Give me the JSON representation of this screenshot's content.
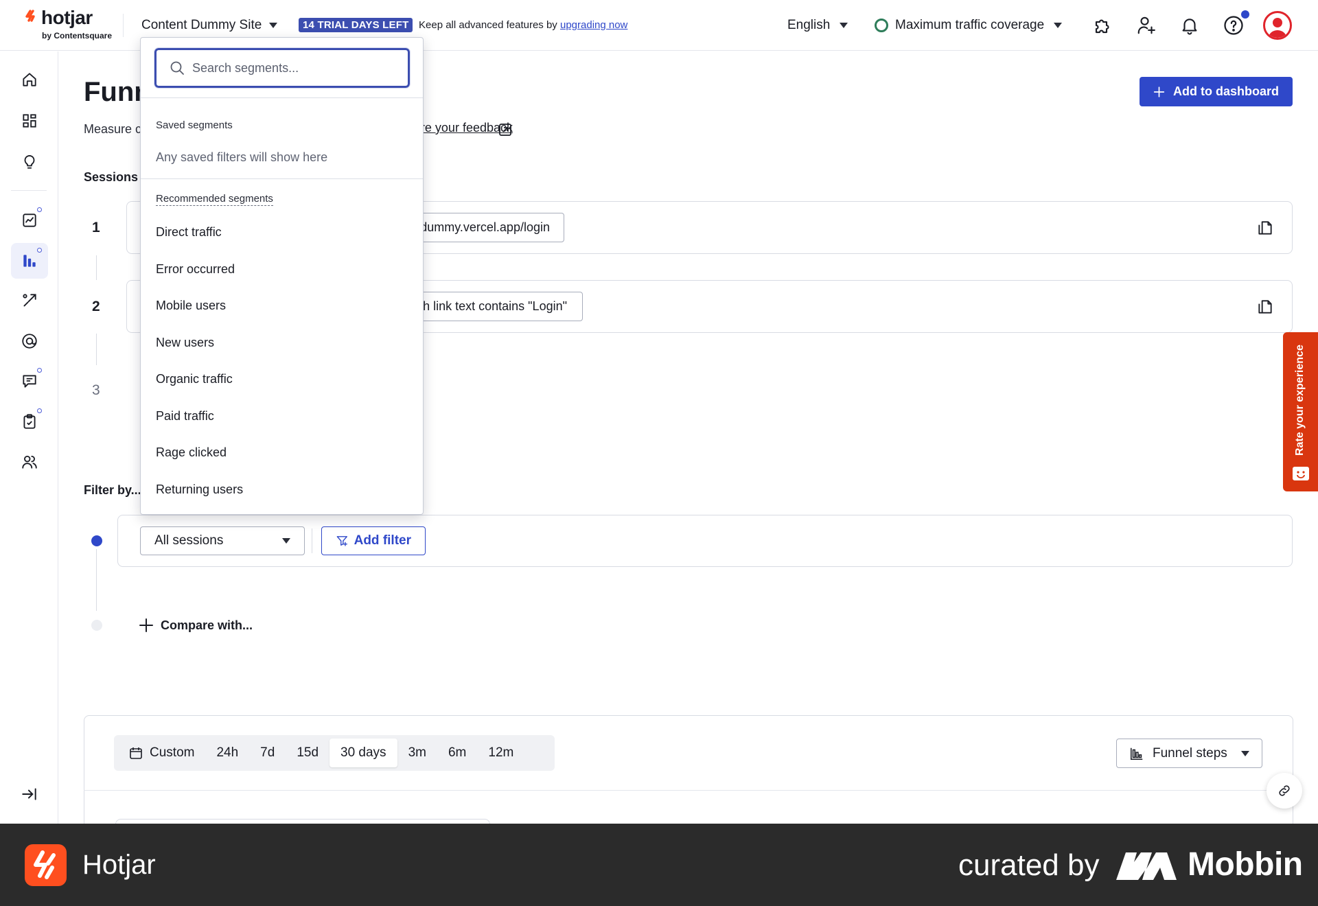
{
  "topbar": {
    "logo_text": "hotjar",
    "logo_sub": "by Contentsquare",
    "site_name": "Content Dummy Site",
    "trial_badge": "14 TRIAL DAYS LEFT",
    "trial_msg": "Keep all advanced features by",
    "upgrade_link": "upgrading now",
    "language": "English",
    "coverage": "Maximum traffic coverage"
  },
  "page": {
    "title": "Funnels",
    "subtitle": "Measure conversion and drop-off through your key flows.",
    "feedback_link": "Share your feedback",
    "add_dashboard": "Add to dashboard",
    "sessions_label": "Sessions",
    "filter_label": "Filter by...",
    "compare_label": "Compare with..."
  },
  "steps": [
    {
      "number": "1",
      "chip": "URL is \"https://content-dummy.vercel.app/login\""
    },
    {
      "number": "2",
      "chip": "Clicked element with link text contains \"Login\""
    },
    {
      "number": "3"
    }
  ],
  "filter": {
    "select_value": "All sessions",
    "add_filter": "Add filter"
  },
  "date_range": {
    "options": [
      "Custom",
      "24h",
      "7d",
      "15d",
      "30 days",
      "3m",
      "6m",
      "12m"
    ],
    "selected": "30 days",
    "view_select": "Funnel steps"
  },
  "rate_tab": "Rate your experience",
  "dropdown": {
    "search_placeholder": "Search segments...",
    "saved_heading": "Saved segments",
    "saved_empty": "Any saved filters will show here",
    "recommended_heading": "Recommended segments",
    "recommended": [
      "Direct traffic",
      "Error occurred",
      "Mobile users",
      "New users",
      "Organic traffic",
      "Paid traffic",
      "Rage clicked",
      "Returning users"
    ]
  },
  "footer": {
    "brand": "Hotjar",
    "curated_by": "curated by",
    "mobbin": "Mobbin"
  },
  "colors": {
    "primary": "#2f48c9",
    "trial_badge": "#3c4eb0",
    "rate_tab": "#d9360f",
    "hotjar_orange": "#ff4f1f",
    "avatar": "#e0242b",
    "footer_bg": "#2b2b2b"
  }
}
